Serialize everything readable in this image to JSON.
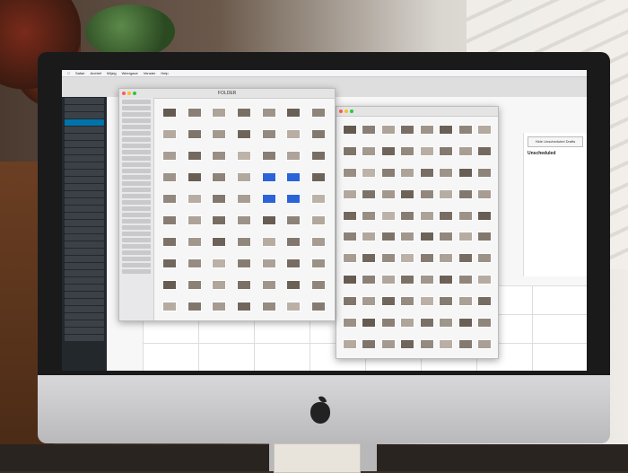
{
  "scene": {
    "device": "iMac",
    "mac_menu": [
      "Safari",
      "Archief",
      "Wijzig",
      "Weergave",
      "Venster",
      "Help"
    ]
  },
  "wordpress": {
    "sidebar_count": 34,
    "active_index": 3,
    "right_panel": {
      "button_label": "Hide Unscheduled Drafts",
      "heading": "Unscheduled"
    }
  },
  "finder_left": {
    "title": "FOLDER",
    "grid_cols": 7,
    "grid_rows": 10,
    "selected_cells": [
      25,
      26,
      32,
      33
    ]
  },
  "finder_right": {
    "grid_cols": 8,
    "grid_rows": 11
  },
  "colors": {
    "wp_sidebar": "#23282d",
    "wp_active": "#0073aa",
    "selection_blue": "#2b64d6"
  }
}
